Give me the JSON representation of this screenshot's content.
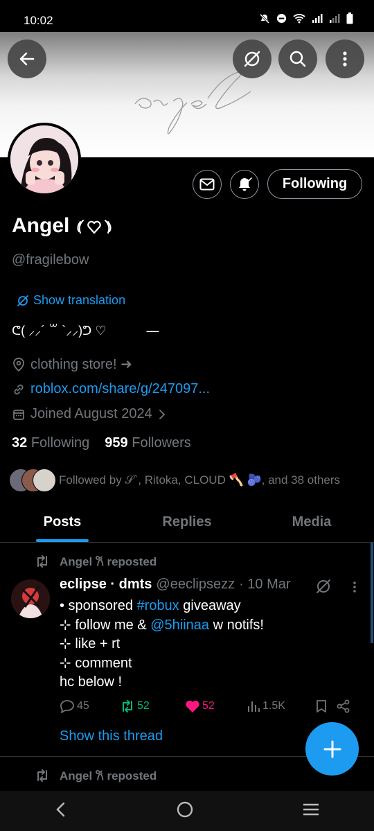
{
  "status_bar": {
    "time": "10:02"
  },
  "banner": {
    "text": "angel"
  },
  "profile": {
    "name": "Angel",
    "name_emoji": "𐙚",
    "handle": "@fragilebow",
    "show_translation": "Show translation",
    "bio_left": "ᕦ( ⸝⸝´ ꒳ `⸝⸝)ᕤ ♡",
    "bio_right": "—",
    "location": "clothing store! ➜",
    "website": "roblox.com/share/g/247097...",
    "joined": "Joined August 2024",
    "following_count": "32",
    "following_label": "Following",
    "followers_count": "959",
    "followers_label": "Followers",
    "followed_by": "Followed by 𝒮`, Ritoka, CLOUD 🪓 🫐, and 38 others"
  },
  "actions": {
    "following_button": "Following"
  },
  "tabs": [
    {
      "label": "Posts",
      "active": true
    },
    {
      "label": "Replies",
      "active": false
    },
    {
      "label": "Media",
      "active": false
    }
  ],
  "post": {
    "repost_label": "Angel 𐙚 reposted",
    "author_name": "eclipse · dmts",
    "author_handle": "@eeclipsezz",
    "date": "· 10 Mar",
    "line1_a": "• sponsored",
    "line1_tag": "#robux",
    "line1_b": "giveaway",
    "line2_a": " ⊹ follow me &",
    "line2_mention": "@5hiinaa",
    "line2_b": "w notifs!",
    "line3": " ⊹ like + rt",
    "line4": " ⊹ comment",
    "line5": "hc below !",
    "replies": "45",
    "reposts": "52",
    "likes": "52",
    "views": "1.5K",
    "show_thread": "Show this thread"
  },
  "next_post": {
    "repost_label": "Angel 𐙚 reposted"
  },
  "colors": {
    "accent": "#1d9bf0",
    "repost_green": "#00ba7c",
    "like_pink": "#f91880",
    "muted": "#71767b"
  }
}
